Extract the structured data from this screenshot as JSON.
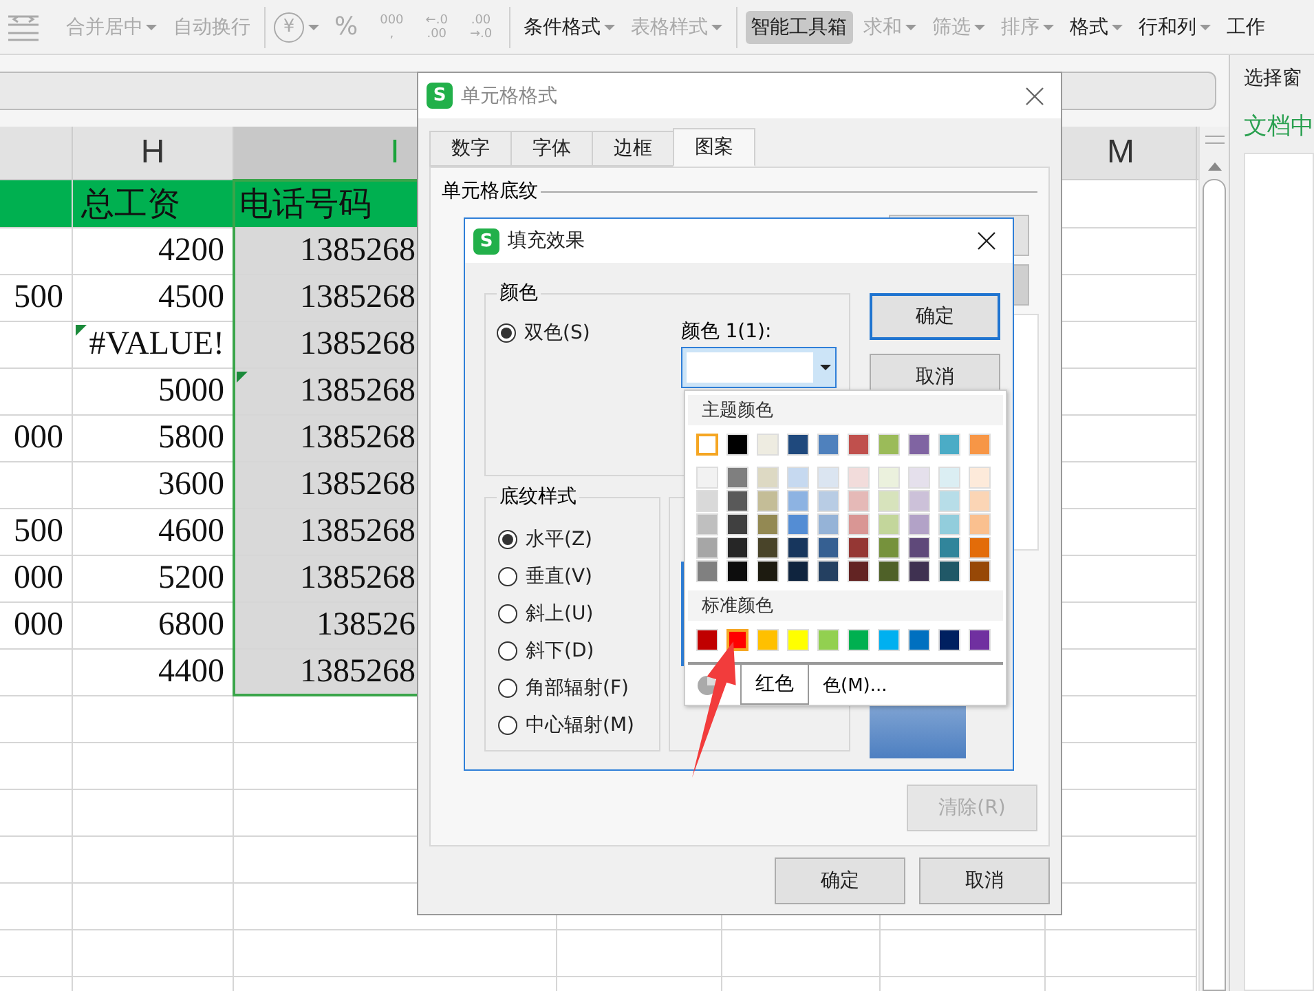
{
  "toolbar": {
    "groups": [
      [
        {
          "kind": "button",
          "label": "合并居中",
          "dropdown": true,
          "disabled": true,
          "active": false
        },
        {
          "kind": "button",
          "label": "自动换行",
          "dropdown": false,
          "disabled": true,
          "active": false
        }
      ],
      [
        {
          "kind": "glyph",
          "lines": [
            "¥"
          ],
          "circled": true,
          "dropdown": true,
          "disabled": true
        },
        {
          "kind": "glyph",
          "lines": [
            "%"
          ],
          "circled": false,
          "dropdown": false,
          "disabled": true
        },
        {
          "kind": "glyph",
          "lines": [
            "000",
            ","
          ],
          "circled": false,
          "dropdown": false,
          "disabled": true
        },
        {
          "kind": "glyph",
          "lines": [
            "←.0",
            ".00"
          ],
          "circled": false,
          "dropdown": false,
          "disabled": true
        },
        {
          "kind": "glyph",
          "lines": [
            ".00",
            "→.0"
          ],
          "circled": false,
          "dropdown": false,
          "disabled": true
        }
      ],
      [
        {
          "kind": "button",
          "label": "条件格式",
          "dropdown": true,
          "disabled": false,
          "active": false
        },
        {
          "kind": "button",
          "label": "表格样式",
          "dropdown": true,
          "disabled": true,
          "active": false
        }
      ],
      [
        {
          "kind": "button",
          "label": "智能工具箱",
          "dropdown": false,
          "disabled": false,
          "active": true
        },
        {
          "kind": "button",
          "label": "求和",
          "dropdown": true,
          "disabled": true,
          "active": false
        },
        {
          "kind": "button",
          "label": "筛选",
          "dropdown": true,
          "disabled": true,
          "active": false
        },
        {
          "kind": "button",
          "label": "排序",
          "dropdown": true,
          "disabled": true,
          "active": false
        },
        {
          "kind": "button",
          "label": "格式",
          "dropdown": true,
          "disabled": false,
          "active": false
        },
        {
          "kind": "button",
          "label": "行和列",
          "dropdown": true,
          "disabled": false,
          "active": false
        },
        {
          "kind": "button",
          "label": "工作",
          "dropdown": false,
          "disabled": false,
          "active": false
        }
      ]
    ]
  },
  "side_panel": {
    "title": "选择窗",
    "subtitle": "文档中"
  },
  "sheet": {
    "columns": [
      {
        "selected": false
      },
      {
        "label": "H",
        "selected": false
      },
      {
        "label": "I",
        "selected": true
      },
      {
        "label": "M",
        "selected": false
      }
    ],
    "rows": [
      {
        "kind": "header",
        "h": "总工资",
        "i": "电话号码",
        "h_flag": false,
        "i_flag": false
      },
      {
        "kind": "data",
        "h": "4200",
        "i": "1385268",
        "h_flag": false,
        "i_flag": false
      },
      {
        "kind": "data",
        "g": "500",
        "h": "4500",
        "i": "1385268",
        "h_flag": false,
        "i_flag": false
      },
      {
        "kind": "data",
        "h": "#VALUE!",
        "i": "1385268",
        "h_flag": true,
        "i_flag": false
      },
      {
        "kind": "data",
        "h": "5000",
        "i": "1385268",
        "h_flag": false,
        "i_flag": true
      },
      {
        "kind": "data",
        "g": "000",
        "h": "5800",
        "i": "1385268",
        "h_flag": false,
        "i_flag": false
      },
      {
        "kind": "data",
        "h": "3600",
        "i": "1385268",
        "h_flag": false,
        "i_flag": false
      },
      {
        "kind": "data",
        "g": "500",
        "h": "4600",
        "i": "1385268",
        "h_flag": false,
        "i_flag": false
      },
      {
        "kind": "data",
        "g": "000",
        "h": "5200",
        "i": "1385268",
        "h_flag": false,
        "i_flag": false
      },
      {
        "kind": "data",
        "g": "000",
        "h": "6800",
        "i": "138526",
        "h_flag": false,
        "i_flag": false
      },
      {
        "kind": "data",
        "h": "4400",
        "i": "1385268",
        "h_flag": false,
        "i_flag": false
      }
    ]
  },
  "format_dialog": {
    "logo": "S",
    "title": "单元格格式",
    "tabs": [
      {
        "label": "数字",
        "selected": false
      },
      {
        "label": "字体",
        "selected": false
      },
      {
        "label": "边框",
        "selected": false
      },
      {
        "label": "图案",
        "selected": true
      }
    ],
    "section": "单元格底纹",
    "clear_button": {
      "label": "清除(R)",
      "disabled": true
    },
    "buttons": [
      "确定",
      "取消"
    ]
  },
  "fill_dialog": {
    "logo": "S",
    "title": "填充效果",
    "colors_group": "颜色",
    "color_mode": {
      "label": "双色(S)",
      "selected": true
    },
    "color1_label": "颜色 1(1):",
    "buttons": [
      {
        "label": "确定",
        "focused": true
      },
      {
        "label": "取消",
        "focused": false
      }
    ],
    "shading_group": "底纹样式",
    "shading_styles": [
      {
        "label": "水平(Z)",
        "selected": true
      },
      {
        "label": "垂直(V)",
        "selected": false
      },
      {
        "label": "斜上(U)",
        "selected": false
      },
      {
        "label": "斜下(D)",
        "selected": false
      },
      {
        "label": "角部辐射(F)",
        "selected": false
      },
      {
        "label": "中心辐射(M)",
        "selected": false
      }
    ]
  },
  "palette": {
    "theme_title": "主题颜色",
    "theme": [
      {
        "color": "#ffffff",
        "selected": true
      },
      {
        "color": "#000000",
        "selected": false
      },
      {
        "color": "#eeece1",
        "selected": false
      },
      {
        "color": "#1f497d",
        "selected": false
      },
      {
        "color": "#4f81bd",
        "selected": false
      },
      {
        "color": "#c0504d",
        "selected": false
      },
      {
        "color": "#9bbb59",
        "selected": false
      },
      {
        "color": "#8064a2",
        "selected": false
      },
      {
        "color": "#4bacc6",
        "selected": false
      },
      {
        "color": "#f79646",
        "selected": false
      }
    ],
    "shades": [
      [
        {
          "color": "#f2f2f2",
          "selected": false
        },
        {
          "color": "#7f7f7f",
          "selected": false
        },
        {
          "color": "#ddd9c3",
          "selected": false
        },
        {
          "color": "#c6d9f0",
          "selected": false
        },
        {
          "color": "#dbe5f1",
          "selected": false
        },
        {
          "color": "#f2dcdb",
          "selected": false
        },
        {
          "color": "#ebf1dd",
          "selected": false
        },
        {
          "color": "#e5e0ec",
          "selected": false
        },
        {
          "color": "#dbeef3",
          "selected": false
        },
        {
          "color": "#fdeada",
          "selected": false
        }
      ],
      [
        {
          "color": "#d9d9d9",
          "selected": false
        },
        {
          "color": "#595959",
          "selected": false
        },
        {
          "color": "#c4bd97",
          "selected": false
        },
        {
          "color": "#8db3e2",
          "selected": false
        },
        {
          "color": "#b8cce4",
          "selected": false
        },
        {
          "color": "#e5b9b7",
          "selected": false
        },
        {
          "color": "#d7e3bc",
          "selected": false
        },
        {
          "color": "#ccc1d9",
          "selected": false
        },
        {
          "color": "#b7dde8",
          "selected": false
        },
        {
          "color": "#fbd5b5",
          "selected": false
        }
      ],
      [
        {
          "color": "#bfbfbf",
          "selected": false
        },
        {
          "color": "#404040",
          "selected": false
        },
        {
          "color": "#938953",
          "selected": false
        },
        {
          "color": "#548dd4",
          "selected": false
        },
        {
          "color": "#95b3d7",
          "selected": false
        },
        {
          "color": "#d99694",
          "selected": false
        },
        {
          "color": "#c3d69b",
          "selected": false
        },
        {
          "color": "#b2a2c7",
          "selected": false
        },
        {
          "color": "#92cddc",
          "selected": false
        },
        {
          "color": "#fac08f",
          "selected": false
        }
      ],
      [
        {
          "color": "#a6a6a6",
          "selected": false
        },
        {
          "color": "#262626",
          "selected": false
        },
        {
          "color": "#494429",
          "selected": false
        },
        {
          "color": "#17365d",
          "selected": false
        },
        {
          "color": "#366092",
          "selected": false
        },
        {
          "color": "#953734",
          "selected": false
        },
        {
          "color": "#76923c",
          "selected": false
        },
        {
          "color": "#5f497a",
          "selected": false
        },
        {
          "color": "#31859b",
          "selected": false
        },
        {
          "color": "#e36c09",
          "selected": false
        }
      ],
      [
        {
          "color": "#808080",
          "selected": false
        },
        {
          "color": "#0d0d0d",
          "selected": false
        },
        {
          "color": "#1d1b10",
          "selected": false
        },
        {
          "color": "#0f243e",
          "selected": false
        },
        {
          "color": "#244061",
          "selected": false
        },
        {
          "color": "#632423",
          "selected": false
        },
        {
          "color": "#4f6128",
          "selected": false
        },
        {
          "color": "#3f3151",
          "selected": false
        },
        {
          "color": "#205867",
          "selected": false
        },
        {
          "color": "#974806",
          "selected": false
        }
      ]
    ],
    "standard_title": "标准颜色",
    "standard": [
      {
        "color": "#c00000",
        "selected": false
      },
      {
        "color": "#ff0000",
        "selected": true
      },
      {
        "color": "#ffc000",
        "selected": false
      },
      {
        "color": "#ffff00",
        "selected": false
      },
      {
        "color": "#92d050",
        "selected": false
      },
      {
        "color": "#00b050",
        "selected": false
      },
      {
        "color": "#00b0f0",
        "selected": false
      },
      {
        "color": "#0070c0",
        "selected": false
      },
      {
        "color": "#002060",
        "selected": false
      },
      {
        "color": "#7030a0",
        "selected": false
      }
    ],
    "more_label": "色(M)...",
    "tooltip": "红色"
  }
}
